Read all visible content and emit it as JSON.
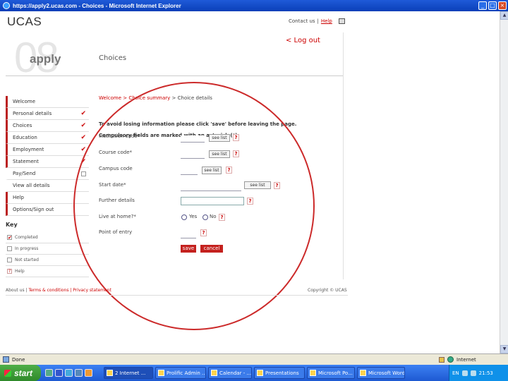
{
  "window": {
    "title": "https://apply2.ucas.com - Choices - Microsoft Internet Explorer"
  },
  "header": {
    "logo": "UCAS",
    "contact": "Contact us",
    "help": "Help",
    "logout": "< Log out",
    "watermark": "08",
    "app_title": "apply",
    "section_title": "Choices"
  },
  "sidebar": {
    "items": [
      {
        "label": "Welcome",
        "checked": false
      },
      {
        "label": "Personal details",
        "checked": true
      },
      {
        "label": "Choices",
        "checked": true
      },
      {
        "label": "Education",
        "checked": true
      },
      {
        "label": "Employment",
        "checked": true
      },
      {
        "label": "Statement",
        "checked": true
      },
      {
        "label": "Pay/Send",
        "checked": false
      },
      {
        "label": "View all details",
        "checked": false
      },
      {
        "label": "Help",
        "checked": false
      },
      {
        "label": "Options/Sign out",
        "checked": false
      }
    ],
    "key_title": "Key",
    "key_items": [
      "Completed",
      "In progress",
      "Not started",
      "Help"
    ]
  },
  "form": {
    "breadcrumb_link": "Welcome > Choice summary",
    "breadcrumb_current": " > Choice details",
    "warning": "To avoid losing information please click 'save' before leaving the page.",
    "compulsory": "Compulsory fields are marked with an asterisk (*).",
    "fields": [
      {
        "label": "Institution code*",
        "button": "see list"
      },
      {
        "label": "Course code*",
        "button": "see list"
      },
      {
        "label": "Campus code",
        "button": "see list"
      },
      {
        "label": "Start date*",
        "button": "see list"
      },
      {
        "label": "Further details"
      },
      {
        "label": "Live at home?*"
      },
      {
        "label": "Point of entry"
      }
    ],
    "radio_yes": "Yes",
    "radio_no": "No",
    "help_mark": "?",
    "save": "save",
    "cancel": "cancel"
  },
  "footer": {
    "about": "About us",
    "terms": "Terms & conditions | Privacy statement",
    "copyright": "Copyright © UCAS"
  },
  "statusbar": {
    "left": "Done",
    "zone": "Internet"
  },
  "taskbar": {
    "start": "start",
    "tasks": [
      "2 Internet ...",
      "Prolific Admin ...",
      "Calendar - ...",
      "Presentations",
      "Microsoft Po...",
      "Microsoft Word"
    ],
    "lang": "EN",
    "clock": "21:53"
  },
  "colors": {
    "accent": "#c4211e",
    "taskbar": "#245edb",
    "start": "#3c9a35"
  }
}
